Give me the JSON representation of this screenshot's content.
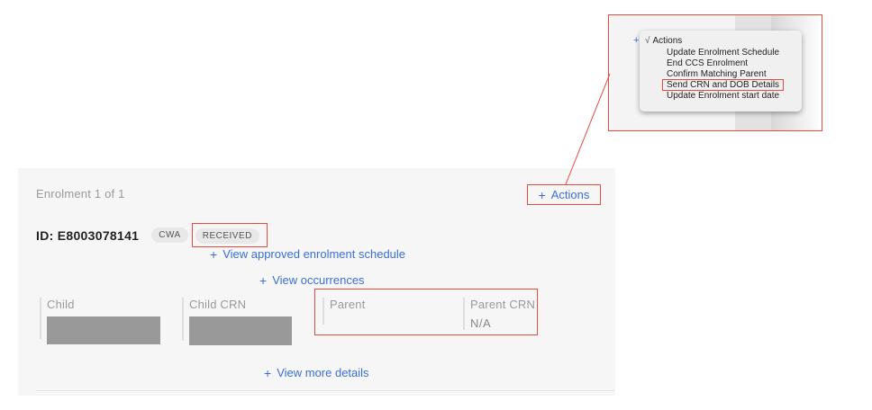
{
  "colors": {
    "accent": "#3b6fd8",
    "highlight": "#e64a3b",
    "card_bg": "#f6f6f6",
    "redaction": "#999999"
  },
  "zoom_menu": {
    "trigger_plus": "+",
    "header_check": "√",
    "header_label": "Actions",
    "items": [
      "Update Enrolment Schedule",
      "End CCS Enrolment",
      "Confirm Matching Parent",
      "Send CRN and DOB Details",
      "Update Enrolment start date"
    ],
    "highlighted_item": "Send CRN and DOB Details"
  },
  "card": {
    "enrolment_count": "Enrolment 1 of 1",
    "actions_button": {
      "icon": "+",
      "label": "Actions"
    },
    "id_label": "ID: E8003078141",
    "badges": {
      "type": "CWA",
      "status": "RECEIVED"
    },
    "links": {
      "schedule": "View approved enrolment schedule",
      "occurrences": "View occurrences",
      "more_details": "View more details",
      "plus": "+"
    },
    "fields": {
      "child": {
        "label": "Child"
      },
      "child_crn": {
        "label": "Child CRN"
      },
      "parent": {
        "label": "Parent",
        "value": ""
      },
      "parent_crn": {
        "label": "Parent CRN",
        "value": "N/A"
      }
    }
  }
}
